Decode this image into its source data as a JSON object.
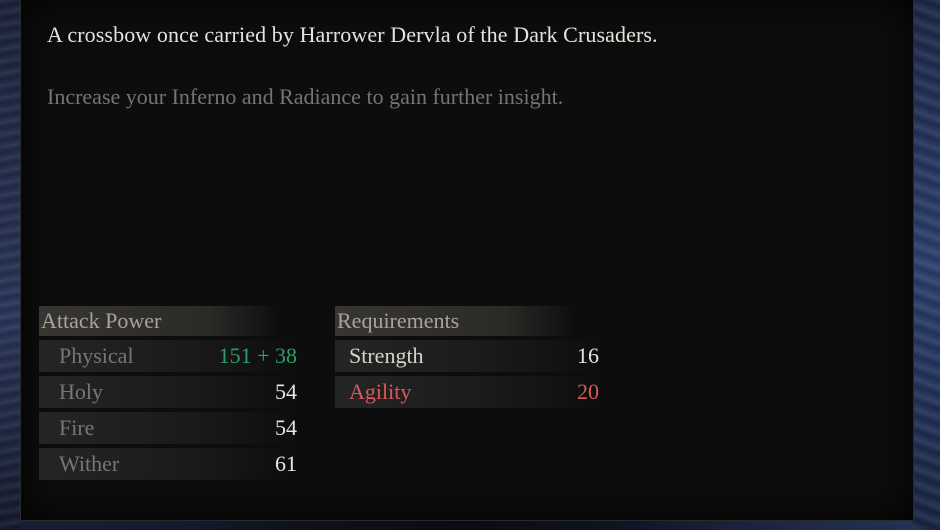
{
  "item": {
    "description": "A crossbow once carried by Harrower Dervla of the Dark Crusaders.",
    "insight_hint": "Increase your Inferno and Radiance to gain further insight."
  },
  "attack_power": {
    "header": "Attack Power",
    "rows": [
      {
        "name": "Physical",
        "value": "151 + 38",
        "value_color": "#2e9e6a"
      },
      {
        "name": "Holy",
        "value": "54"
      },
      {
        "name": "Fire",
        "value": "54"
      },
      {
        "name": "Wither",
        "value": "61"
      }
    ]
  },
  "requirements": {
    "header": "Requirements",
    "rows": [
      {
        "name": "Strength",
        "value": "16",
        "met": true
      },
      {
        "name": "Agility",
        "value": "20",
        "met": false,
        "color": "#d9585a"
      }
    ]
  },
  "colors": {
    "panel_bg": "#0d0d0d",
    "text_primary": "#e6e3dc",
    "text_muted": "#77746e",
    "bonus_green": "#2e9e6a",
    "unmet_red": "#d9585a"
  }
}
